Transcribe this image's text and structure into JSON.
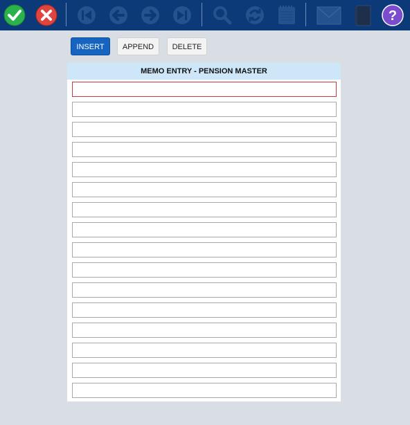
{
  "toolbar": {
    "buttons": [
      {
        "name": "ok-button",
        "icon": "check-icon",
        "label": "OK",
        "color": "#2bb24c",
        "enabled": true
      },
      {
        "name": "cancel-button",
        "icon": "close-icon",
        "label": "Cancel",
        "color": "#e0443e",
        "enabled": true
      },
      {
        "name": "first-record-button",
        "icon": "skip-first-icon",
        "label": "First",
        "enabled": false
      },
      {
        "name": "previous-record-button",
        "icon": "arrow-left-icon",
        "label": "Previous",
        "enabled": false
      },
      {
        "name": "next-record-button",
        "icon": "arrow-right-icon",
        "label": "Next",
        "enabled": false
      },
      {
        "name": "last-record-button",
        "icon": "skip-last-icon",
        "label": "Last",
        "enabled": false
      },
      {
        "name": "search-button",
        "icon": "search-icon",
        "label": "Search",
        "enabled": false
      },
      {
        "name": "refresh-button",
        "icon": "refresh-icon",
        "label": "Refresh",
        "enabled": false
      },
      {
        "name": "notes-button",
        "icon": "notepad-icon",
        "label": "Notes",
        "enabled": false
      },
      {
        "name": "mail-button",
        "icon": "mail-icon",
        "label": "Mail",
        "enabled": false
      },
      {
        "name": "book-button",
        "icon": "book-icon",
        "label": "Book",
        "enabled": false
      },
      {
        "name": "help-button",
        "icon": "help-icon",
        "label": "Help",
        "color": "#7c4ccf",
        "enabled": true
      }
    ]
  },
  "actions": {
    "insert_label": "INSERT",
    "append_label": "APPEND",
    "delete_label": "DELETE"
  },
  "memo": {
    "title": "MEMO ENTRY - PENSION MASTER",
    "lines": [
      "",
      "",
      "",
      "",
      "",
      "",
      "",
      "",
      "",
      "",
      "",
      "",
      "",
      "",
      "",
      ""
    ]
  },
  "colors": {
    "toolbar_bg": "#0c3a78",
    "page_bg": "#d9dde4",
    "header_bg": "#cde7f8",
    "primary_button": "#1565c0",
    "active_border": "#c43b3b"
  }
}
